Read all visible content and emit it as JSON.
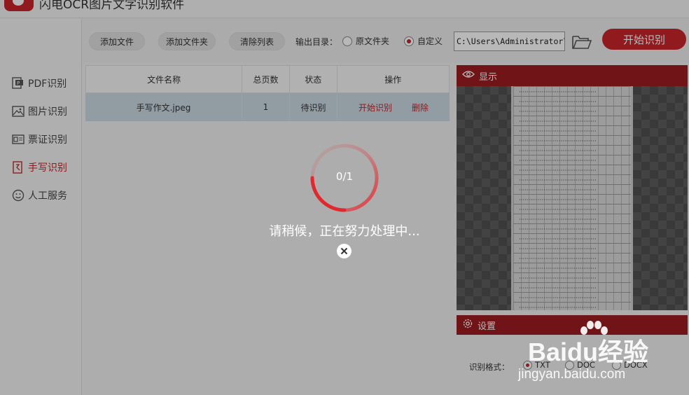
{
  "app": {
    "title": "闪电OCR图片文字识别软件"
  },
  "sidebar": {
    "items": [
      {
        "label": "PDF识别",
        "icon": "pdf-icon"
      },
      {
        "label": "图片识别",
        "icon": "image-icon"
      },
      {
        "label": "票证识别",
        "icon": "ticket-icon"
      },
      {
        "label": "手写识别",
        "icon": "handwriting-icon",
        "active": true
      },
      {
        "label": "人工服务",
        "icon": "smiley-icon"
      }
    ]
  },
  "toolbar": {
    "add_file": "添加文件",
    "add_folder": "添加文件夹",
    "clear_list": "清除列表",
    "output_label": "输出目录：",
    "opt_original": "原文件夹",
    "opt_custom": "自定义",
    "selected_output": "自定义",
    "path_value": "C:\\Users\\Administrator\\De",
    "start": "开始识别"
  },
  "table": {
    "columns": [
      "文件名称",
      "总页数",
      "状态",
      "操作"
    ],
    "rows": [
      {
        "name": "手写作文.jpeg",
        "pages": "1",
        "status": "待识别",
        "op_start": "开始识别",
        "op_delete": "删除"
      }
    ]
  },
  "preview": {
    "title": "显示"
  },
  "settings": {
    "title": "设置",
    "format_label": "识别格式：",
    "formats": [
      "TXT",
      "DOC",
      "DOCX"
    ],
    "selected_format": "TXT"
  },
  "overlay": {
    "progress": "0/1",
    "progress_fraction": 0,
    "message": "请稍候，正在努力处理中..."
  },
  "watermark": {
    "logo": "Baidu经验",
    "url": "jingyan.baidu.com"
  },
  "colors": {
    "accent": "#c9242b",
    "dark_red": "#9b1c21",
    "selected_row": "#c9d9e2"
  }
}
